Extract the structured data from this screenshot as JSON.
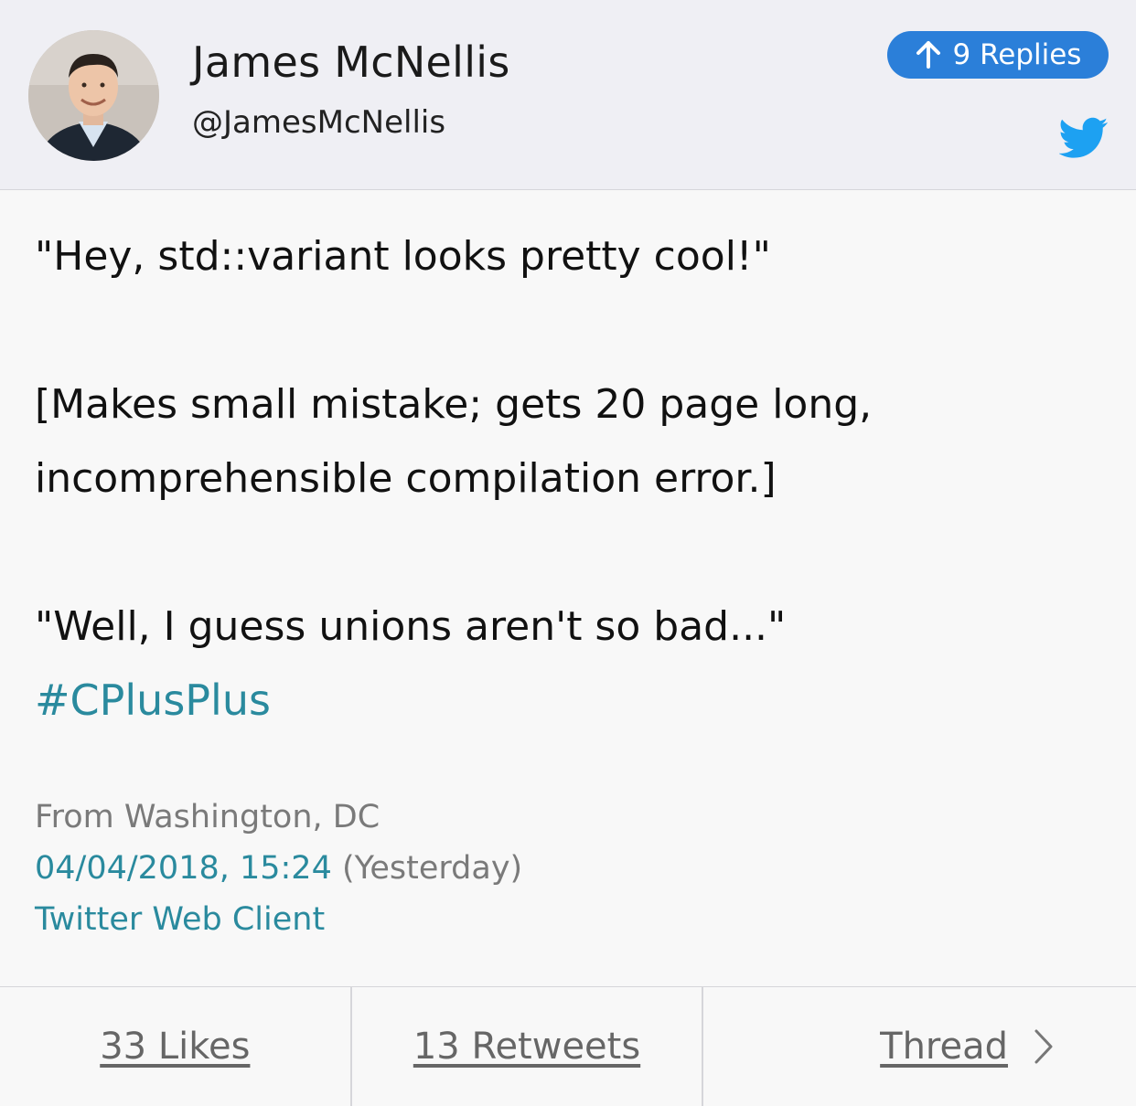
{
  "author": {
    "name": "James McNellis",
    "handle": "@JamesMcNellis"
  },
  "replies_button": {
    "label": "9 Replies",
    "icon": "arrow-up-icon"
  },
  "platform_icon": "twitter-bird-icon",
  "tweet": {
    "line1": "\"Hey, std::variant looks pretty cool!\"",
    "line2": "[Makes small mistake; gets 20 page long,",
    "line3": "incomprehensible compilation error.]",
    "line4": "\"Well, I guess unions aren't so bad...\"",
    "hashtag": "#CPlusPlus"
  },
  "meta": {
    "location": "From Washington, DC",
    "datetime": "04/04/2018, 15:24",
    "relative": "(Yesterday)",
    "client": "Twitter Web Client"
  },
  "footer": {
    "likes": "33 Likes",
    "retweets": "13 Retweets",
    "thread": "Thread"
  },
  "colors": {
    "header_bg": "#efeff4",
    "accent_blue": "#2b7fd9",
    "twitter_blue": "#1da1f2",
    "link_teal": "#2a8a9e"
  }
}
